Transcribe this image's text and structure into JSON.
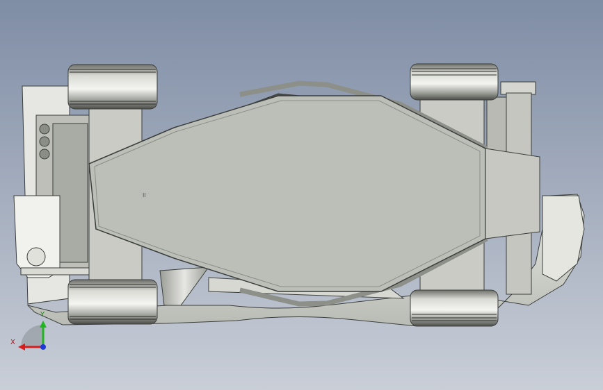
{
  "viewport": {
    "background_top": "#7f8da5",
    "background_bottom": "#c9ced7",
    "triad": {
      "x_label": "X",
      "y_label": "Y",
      "x_color": "#d81c1c",
      "y_color": "#1fb51f",
      "z_color": "#1f38d8"
    }
  },
  "model": {
    "icon": "car-chassis-underside",
    "panel_fill": "#bcbfb7",
    "edge_color": "#3a3d3a"
  }
}
